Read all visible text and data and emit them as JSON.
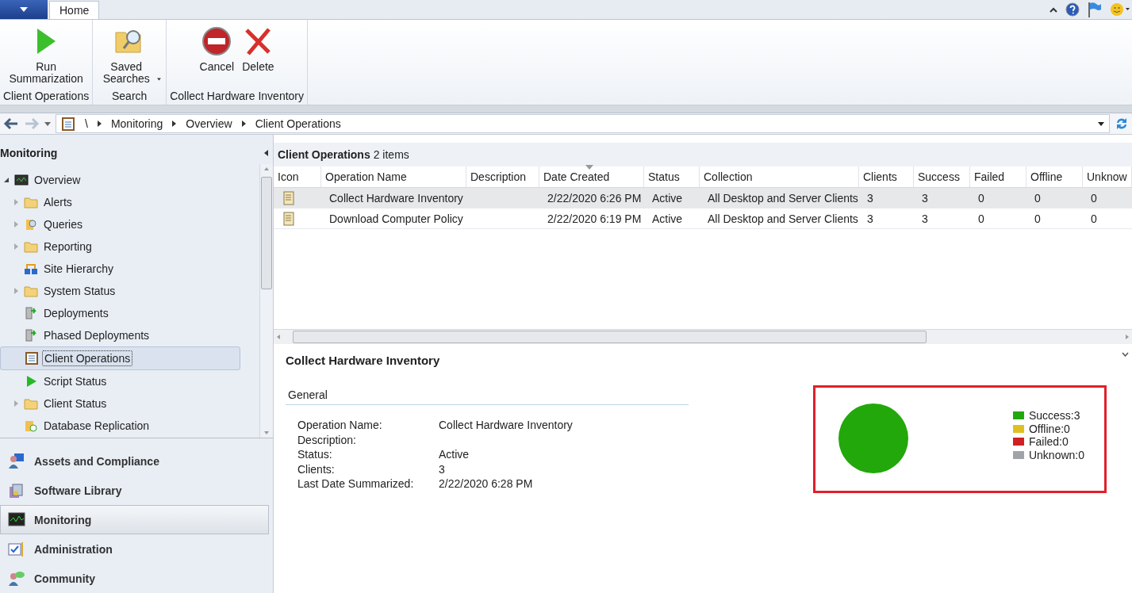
{
  "ribbon_tabs": [
    {
      "label": "Home",
      "selected": true
    }
  ],
  "ribbon_groups": [
    {
      "label": "Client Operations",
      "buttons": [
        {
          "label": "Run Summarization",
          "dropdown": false
        }
      ]
    },
    {
      "label": "Search",
      "buttons": [
        {
          "label": "Saved Searches",
          "dropdown": true
        }
      ]
    },
    {
      "label": "Collect Hardware Inventory",
      "buttons": [
        {
          "label": "Cancel",
          "dropdown": false
        },
        {
          "label": "Delete",
          "dropdown": false
        }
      ]
    }
  ],
  "breadcrumb": [
    "\\",
    "Monitoring",
    "Overview",
    "Client Operations"
  ],
  "navigation": {
    "title": "Monitoring",
    "tree": [
      {
        "label": "Overview",
        "expanded": true,
        "selected": false,
        "children": [
          {
            "label": "Alerts",
            "expanded": false,
            "selected": false
          },
          {
            "label": "Queries",
            "expanded": false,
            "selected": false
          },
          {
            "label": "Reporting",
            "expanded": false,
            "selected": false
          },
          {
            "label": "Site Hierarchy",
            "selected": false
          },
          {
            "label": "System Status",
            "expanded": false,
            "selected": false
          },
          {
            "label": "Deployments",
            "selected": false
          },
          {
            "label": "Phased Deployments",
            "selected": false
          },
          {
            "label": "Client Operations",
            "selected": true
          },
          {
            "label": "Script Status",
            "selected": false
          },
          {
            "label": "Client Status",
            "expanded": false,
            "selected": false
          },
          {
            "label": "Database Replication",
            "selected": false
          }
        ]
      }
    ],
    "workspaces": [
      {
        "label": "Assets and Compliance",
        "selected": false
      },
      {
        "label": "Software Library",
        "selected": false
      },
      {
        "label": "Monitoring",
        "selected": true
      },
      {
        "label": "Administration",
        "selected": false
      },
      {
        "label": "Community",
        "selected": false
      }
    ]
  },
  "list": {
    "title": "Client Operations",
    "count": "2 items",
    "columns": [
      {
        "label": "Icon",
        "sorted": false
      },
      {
        "label": "Operation Name",
        "sorted": false
      },
      {
        "label": "Description",
        "sorted": false
      },
      {
        "label": "Date Created",
        "sorted": true
      },
      {
        "label": "Status",
        "sorted": false
      },
      {
        "label": "Collection",
        "sorted": false
      },
      {
        "label": "Clients",
        "sorted": false
      },
      {
        "label": "Success",
        "sorted": false
      },
      {
        "label": "Failed",
        "sorted": false
      },
      {
        "label": "Offline",
        "sorted": false
      },
      {
        "label": "Unknow",
        "sorted": false
      }
    ],
    "rows": [
      {
        "selected": true,
        "cells": [
          "",
          "Collect Hardware Inventory",
          "",
          "2/22/2020 6:26 PM",
          "Active",
          "All Desktop and Server Clients",
          "3",
          "3",
          "0",
          "0",
          "0"
        ]
      },
      {
        "selected": false,
        "cells": [
          "",
          "Download Computer Policy",
          "",
          "2/22/2020 6:19 PM",
          "Active",
          "All Desktop and Server Clients",
          "3",
          "3",
          "0",
          "0",
          "0"
        ]
      }
    ]
  },
  "details": {
    "title": "Collect Hardware Inventory",
    "section": "General",
    "fields": [
      {
        "label": "Operation Name:",
        "value": "Collect Hardware Inventory"
      },
      {
        "label": "Description:"
      },
      {
        "label": "Status:",
        "value": "Active"
      },
      {
        "label": "Clients:",
        "value": "3"
      },
      {
        "label": "Last Date Summarized:",
        "value": "2/22/2020 6:28 PM"
      }
    ],
    "chart_data": {
      "type": "pie",
      "values": [
        100,
        0,
        0,
        0
      ]
    },
    "legend": [
      {
        "label": "Success:3",
        "color": "#22a80a"
      },
      {
        "label": "Offline:0",
        "color": "#e0c020"
      },
      {
        "label": "Failed:0",
        "color": "#d02020"
      },
      {
        "label": "Unknown:0",
        "color": "#a0a4a8"
      }
    ]
  }
}
